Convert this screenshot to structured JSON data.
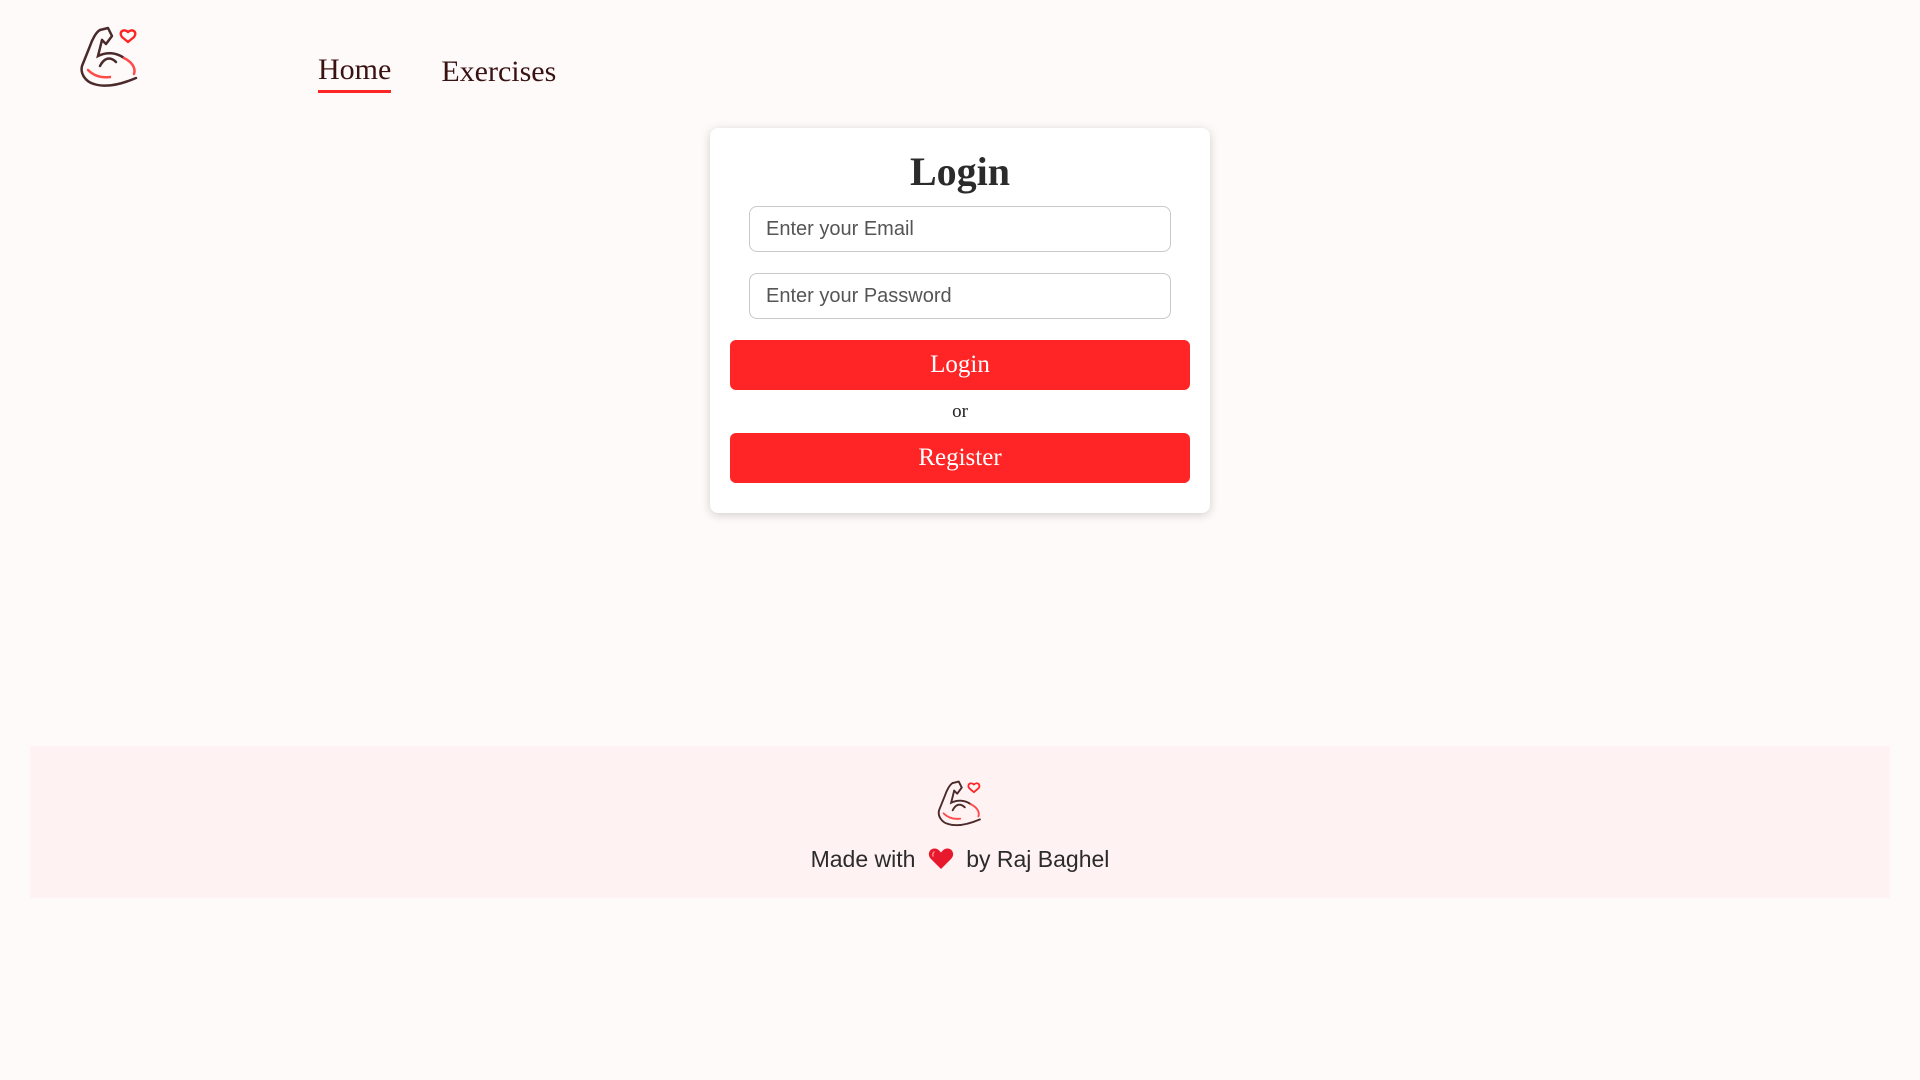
{
  "header": {
    "logo_icon": "flexed-bicep-heart-icon",
    "nav": [
      {
        "label": "Home",
        "active": true
      },
      {
        "label": "Exercises",
        "active": false
      }
    ]
  },
  "login_card": {
    "title": "Login",
    "email_placeholder": "Enter your Email",
    "password_placeholder": "Enter your Password",
    "login_button": "Login",
    "separator": "or",
    "register_button": "Register"
  },
  "footer": {
    "logo_icon": "flexed-bicep-heart-icon",
    "made_with": "Made with",
    "heart_icon": "heart-icon",
    "by_text": "by Raj Baghel"
  },
  "colors": {
    "accent": "#ff2526",
    "background": "#fffafa",
    "footer_background": "#fff2f2"
  }
}
